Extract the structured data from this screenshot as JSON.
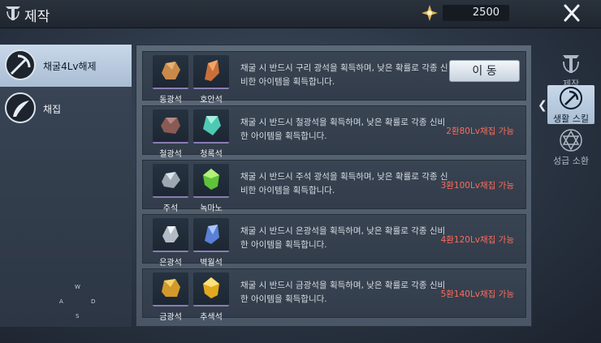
{
  "header": {
    "title": "제작",
    "currency_value": "2500"
  },
  "sidebar": {
    "items": [
      {
        "label": "채굴4Lv해제",
        "active": true
      },
      {
        "label": "채집",
        "active": false
      }
    ],
    "compass": {
      "n": "W",
      "w": "A",
      "e": "D",
      "s": "S"
    }
  },
  "rows": [
    {
      "slot1": "동광석",
      "slot2": "호안석",
      "desc": "채굴 시 반드시 구리 광석을 획득하며, 낮은 확률로 각종 신비한 아이템을 획득합니다.",
      "action": "이 동"
    },
    {
      "slot1": "철광석",
      "slot2": "청록석",
      "desc": "채굴 시 반드시 철광석을 획득하며, 낮은 확률로 각종 신비한 아이템을 획득합니다.",
      "status": "2환80Lv채집 가능"
    },
    {
      "slot1": "주석",
      "slot2": "녹마노",
      "desc": "채굴 시 반드시 주석 광석을 획득하며, 낮은 확률로 각종 신비한 아이템을 획득합니다.",
      "status": "3환100Lv채집 가능"
    },
    {
      "slot1": "은광석",
      "slot2": "벽월석",
      "desc": "채굴 시 반드시 은광석을 획득하며, 낮은 확률로 각종 신비한 아이템을 획득합니다.",
      "status": "4환120Lv채집 가능"
    },
    {
      "slot1": "금광석",
      "slot2": "추색석",
      "desc": "채굴 시 반드시 금광석을 획득하며, 낮은 확률로 각종 신비한 아이템을 획득합니다.",
      "status": "5환140Lv채집 가능"
    }
  ],
  "right_nav": [
    {
      "label": "제작",
      "active": false
    },
    {
      "label": "생활 스킬",
      "active": true
    },
    {
      "label": "성급 소환",
      "active": false
    }
  ],
  "colors": {
    "status_red": "#ff6a5a",
    "active_blue": "#c9d8ea"
  }
}
